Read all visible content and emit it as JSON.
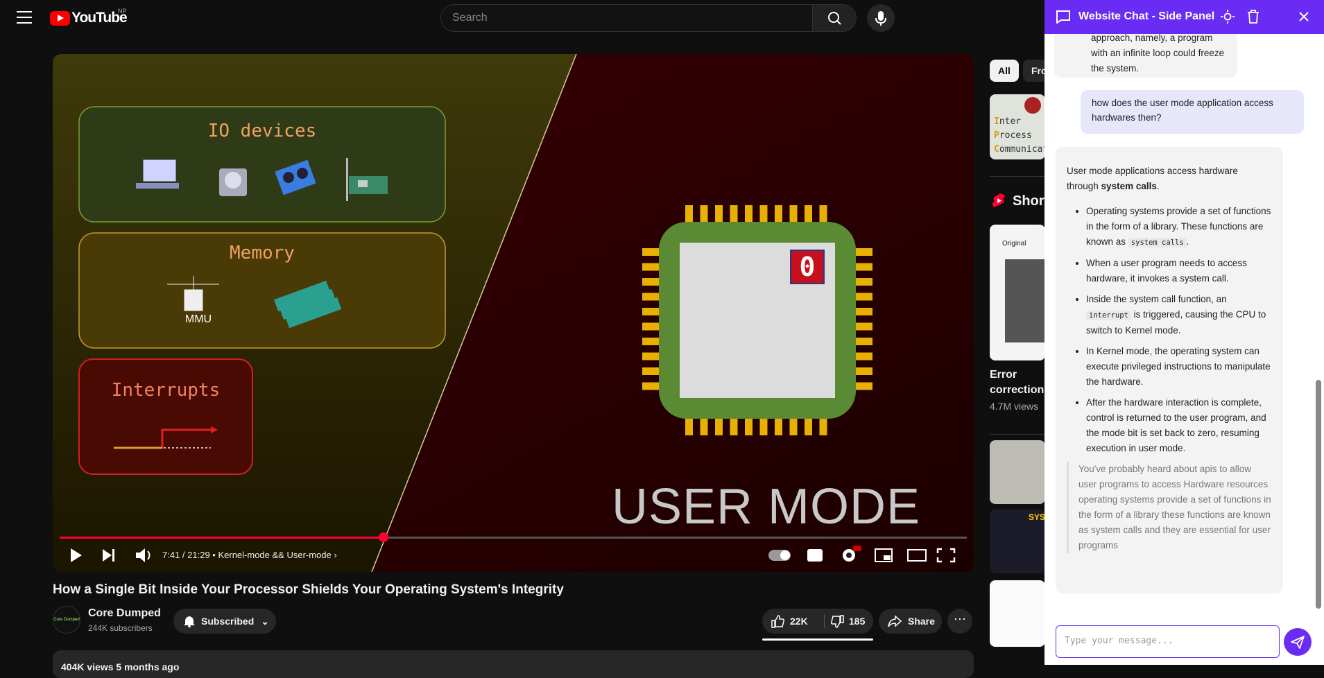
{
  "youtube": {
    "logo_text": "YouTube",
    "region": "NP",
    "search_placeholder": "Search"
  },
  "video": {
    "slide": {
      "box1": "IO devices",
      "box2": "Memory",
      "mmu": "MMU",
      "box3": "Interrupts",
      "cpu_bit": "0",
      "mode": "USER MODE"
    },
    "progress": 0.357,
    "time": "7:41 / 21:29",
    "chapter": "Kernel-mode && User-mode"
  },
  "meta": {
    "title": "How a Single Bit Inside Your Processor Shields Your Operating System's Integrity",
    "channel": "Core Dumped",
    "channel_avatar": "Core Dumped",
    "subs": "244K subscribers",
    "subscribed": "Subscribed",
    "likes": "22K",
    "dislikes": "185",
    "share": "Share",
    "desc": "404K views  5 months ago"
  },
  "sidebar": {
    "chip_all": "All",
    "chip_fro": "Fro",
    "rec1_l1": "nter",
    "rec1_l1a": "I",
    "rec1_l2a": "P",
    "rec1_l2": "rocess",
    "rec1_l3a": "C",
    "rec1_l3": "ommunicat",
    "shorts": "Short",
    "short_orig": "Original",
    "short_title1": "Error",
    "short_title2": "correction",
    "short_views": "4.7M views",
    "sys_label": "SYS"
  },
  "panel": {
    "title": "Website Chat - Side Panel",
    "ai_prev": "approach, namely, a program with an infinite loop could freeze the system.",
    "user_msg": "how does the user mode application access hardwares then?",
    "ai_intro": "User mode applications access hardware through ",
    "ai_intro_bold": "system calls",
    "ai_intro_end": ".",
    "b1": "Operating systems provide a set of functions in the form of a library. These functions are known as ",
    "b1_code": "system calls",
    "b1_end": ".",
    "b2": "When a user program needs to access hardware, it invokes a system call.",
    "b3a": "Inside the system call function, an ",
    "b3_code": "interrupt",
    "b3b": " is triggered, causing the CPU to switch to Kernel mode.",
    "b4": "In Kernel mode, the operating system can execute privileged instructions to manipulate the hardware.",
    "b5": "After the hardware interaction is complete, control is returned to the user program, and the mode bit is set back to zero, resuming execution in user mode.",
    "quote": "You've probably heard about apis to allow user programs to access Hardware resources operating systems provide a set of functions in the form of a library these functions are known as system calls and they are essential for user programs",
    "input_placeholder": "Type your message..."
  },
  "colors": {
    "accent": "#6a2cf5",
    "yt_red": "#ff0000"
  }
}
